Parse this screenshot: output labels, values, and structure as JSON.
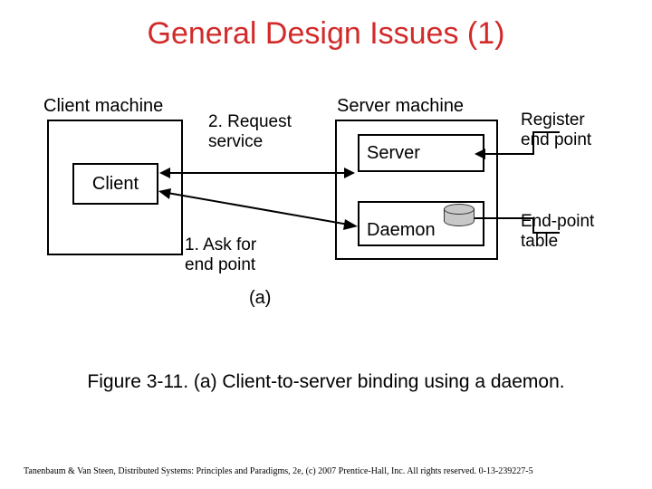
{
  "title": "General Design Issues (1)",
  "diagram": {
    "client_machine_label": "Client machine",
    "server_machine_label": "Server machine",
    "client_box": "Client",
    "server_box": "Server",
    "daemon_box": "Daemon",
    "request_service_label": "2. Request\nservice",
    "ask_endpoint_label": "1. Ask for\nend point",
    "register_label": "Register\nend point",
    "endpoint_table_label": "End-point\ntable",
    "sub_label": "(a)"
  },
  "caption": "Figure 3-11. (a) Client-to-server binding using a daemon.",
  "footer": "Tanenbaum & Van Steen, Distributed Systems: Principles and Paradigms, 2e, (c) 2007 Prentice-Hall, Inc. All rights reserved. 0-13-239227-5"
}
